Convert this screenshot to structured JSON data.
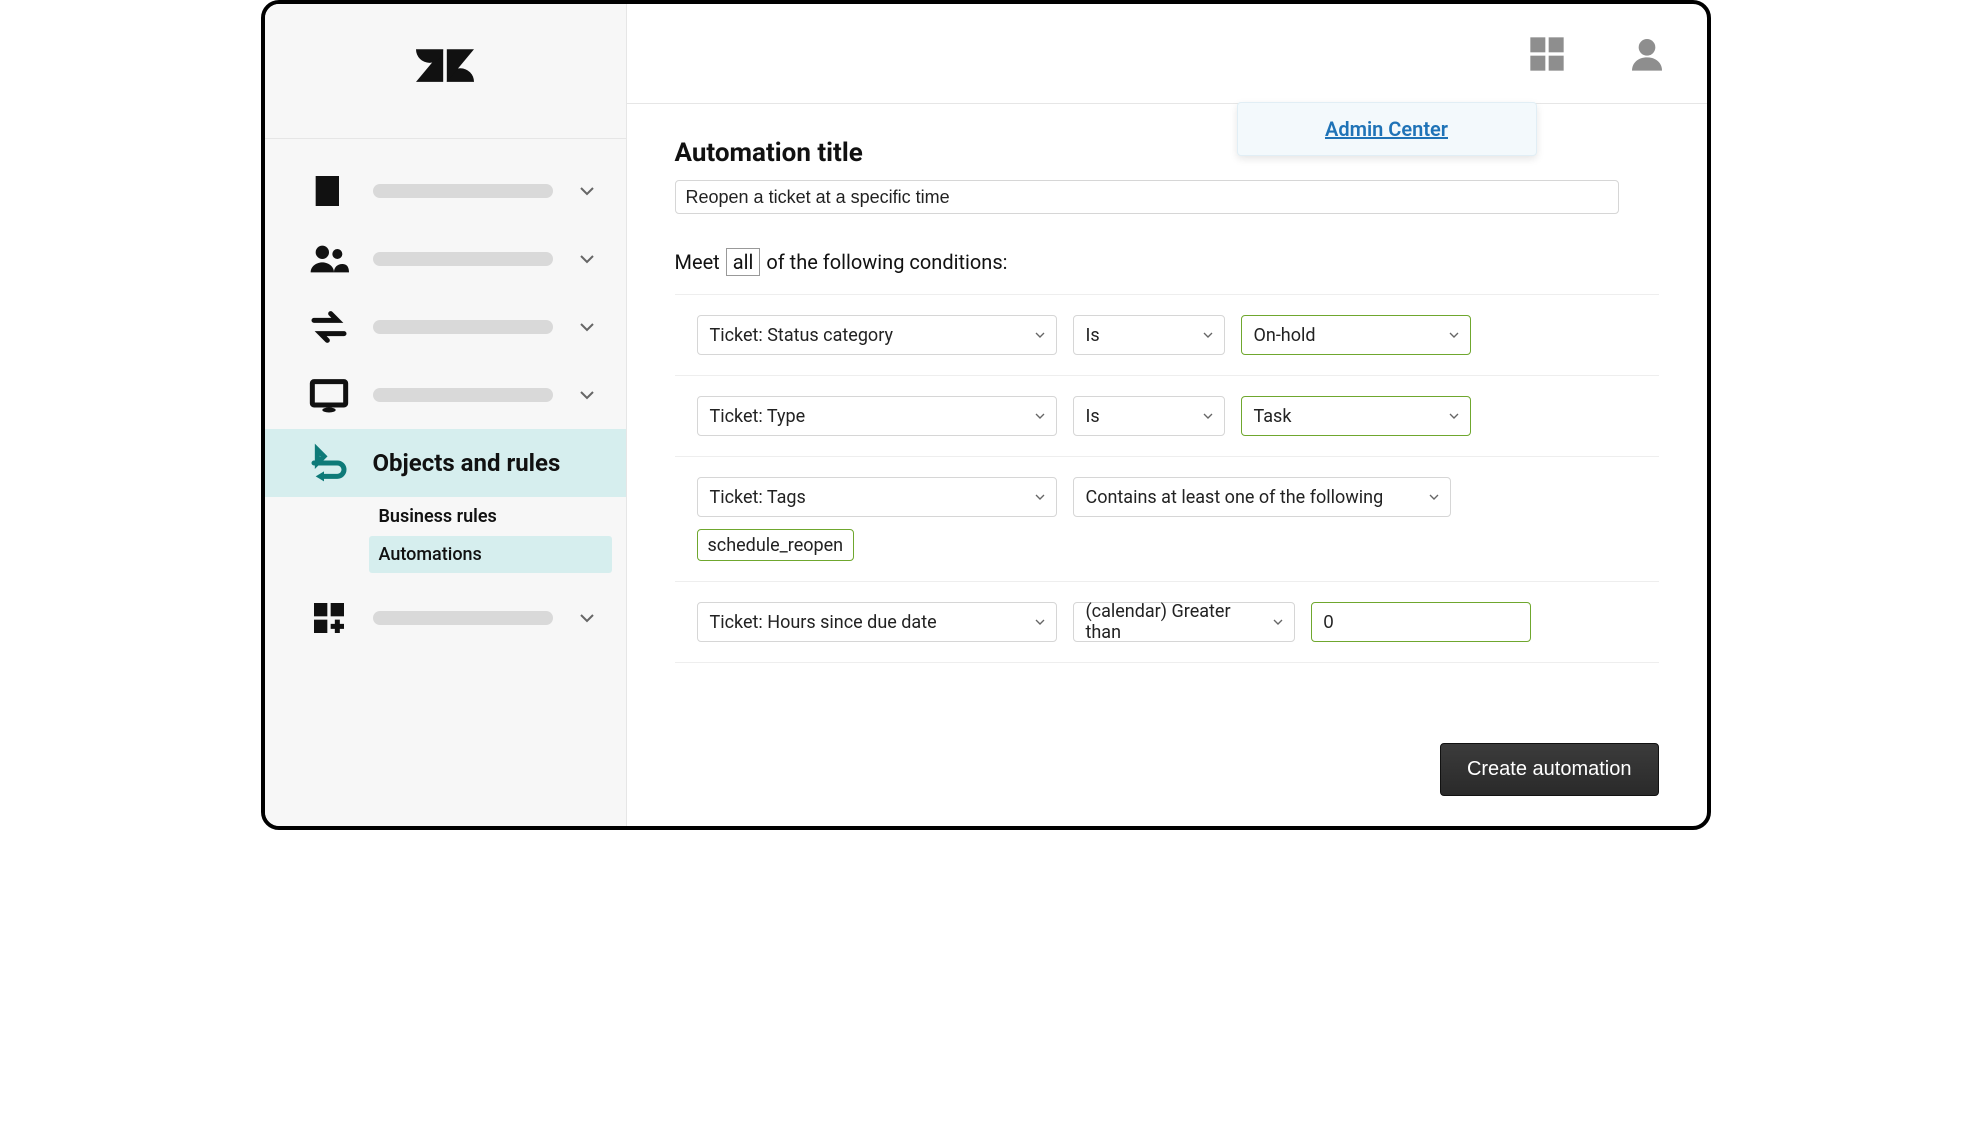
{
  "header": {
    "admin_center_label": "Admin Center"
  },
  "sidebar": {
    "active_label": "Objects and rules",
    "subnav": {
      "business_rules": "Business rules",
      "automations": "Automations"
    }
  },
  "form": {
    "title_label": "Automation title",
    "title_value": "Reopen a ticket at a specific time",
    "meet_prefix": "Meet",
    "meet_match": "all",
    "meet_suffix": "of the following conditions:",
    "conditions": {
      "c1": {
        "field": "Ticket: Status category",
        "op": "Is",
        "val": "On-hold"
      },
      "c2": {
        "field": "Ticket: Type",
        "op": "Is",
        "val": "Task"
      },
      "c3": {
        "field": "Ticket: Tags",
        "op": "Contains at least one of the following",
        "tag": "schedule_reopen"
      },
      "c4": {
        "field": "Ticket: Hours since due date",
        "op": "(calendar) Greater than",
        "val": "0"
      }
    },
    "create_button": "Create automation"
  }
}
